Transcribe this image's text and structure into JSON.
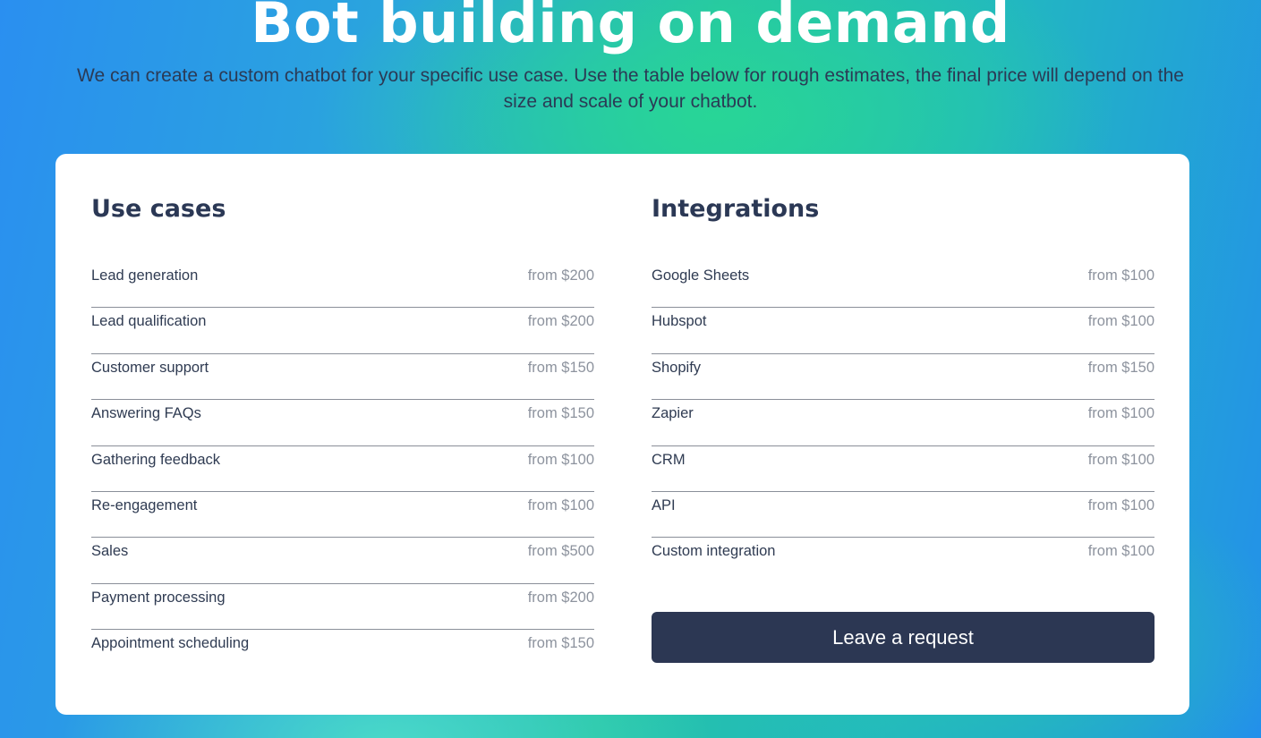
{
  "hero": {
    "title": "Bot building on demand",
    "subtitle": "We can create a custom chatbot for your specific use case. Use the table below for rough estimates, the final price will depend on the size and scale of your chatbot."
  },
  "use_cases": {
    "heading": "Use cases",
    "items": [
      {
        "label": "Lead generation",
        "price": "from $200"
      },
      {
        "label": "Lead qualification",
        "price": "from $200"
      },
      {
        "label": "Customer support",
        "price": "from $150"
      },
      {
        "label": "Answering FAQs",
        "price": "from $150"
      },
      {
        "label": "Gathering feedback",
        "price": "from $100"
      },
      {
        "label": "Re-engagement",
        "price": "from $100"
      },
      {
        "label": "Sales",
        "price": "from $500"
      },
      {
        "label": "Payment processing",
        "price": "from $200"
      },
      {
        "label": "Appointment scheduling",
        "price": "from $150"
      }
    ]
  },
  "integrations": {
    "heading": "Integrations",
    "items": [
      {
        "label": "Google Sheets",
        "price": "from $100"
      },
      {
        "label": "Hubspot",
        "price": "from $100"
      },
      {
        "label": "Shopify",
        "price": "from $150"
      },
      {
        "label": "Zapier",
        "price": "from $100"
      },
      {
        "label": "CRM",
        "price": "from $100"
      },
      {
        "label": "API",
        "price": "from $100"
      },
      {
        "label": "Custom integration",
        "price": "from $100"
      }
    ]
  },
  "cta": {
    "label": "Leave a request"
  },
  "colors": {
    "button_bg": "#2c3753",
    "heading_text": "#2b3855",
    "price_text": "#8d939e",
    "gradient_blue": "#2a8ff0",
    "gradient_green": "#28d696"
  }
}
